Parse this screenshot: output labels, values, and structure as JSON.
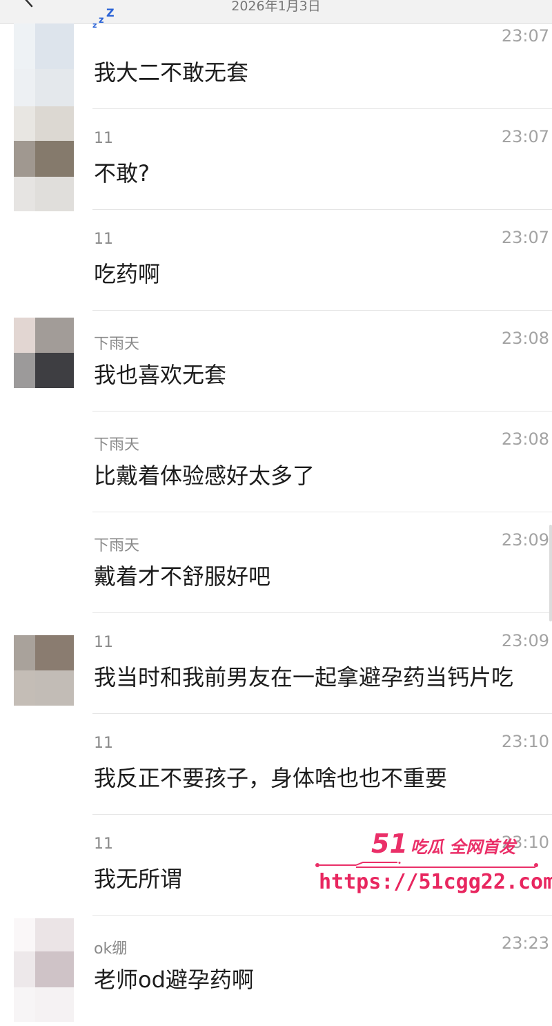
{
  "header": {
    "date": "2026年1月3日"
  },
  "messages": [
    {
      "sender": "",
      "time": "23:07",
      "text": "我大二不敢无套"
    },
    {
      "sender": "11",
      "time": "23:07",
      "text": "不敢?"
    },
    {
      "sender": "11",
      "time": "23:07",
      "text": "吃药啊"
    },
    {
      "sender": "下雨天",
      "time": "23:08",
      "text": "我也喜欢无套"
    },
    {
      "sender": "下雨天",
      "time": "23:08",
      "text": "比戴着体验感好太多了"
    },
    {
      "sender": "下雨天",
      "time": "23:09",
      "text": "戴着才不舒服好吧"
    },
    {
      "sender": "11",
      "time": "23:09",
      "text": "我当时和我前男友在一起拿避孕药当钙片吃"
    },
    {
      "sender": "11",
      "time": "23:10",
      "text": "我反正不要孩子，身体啥也也不重要"
    },
    {
      "sender": "11",
      "time": "23:10",
      "text": "我无所谓"
    },
    {
      "sender": "ok绷",
      "time": "23:23",
      "text": "老师od避孕药啊"
    }
  ],
  "icons": {
    "back": "chevron-left-icon",
    "sleepy_nickname": "zzz-sleep-icon"
  },
  "watermark": {
    "brand_number": "51",
    "brand_text": "吃瓜 全网首发",
    "url": "https://51cgg22.com",
    "color": "#ea2f68"
  }
}
